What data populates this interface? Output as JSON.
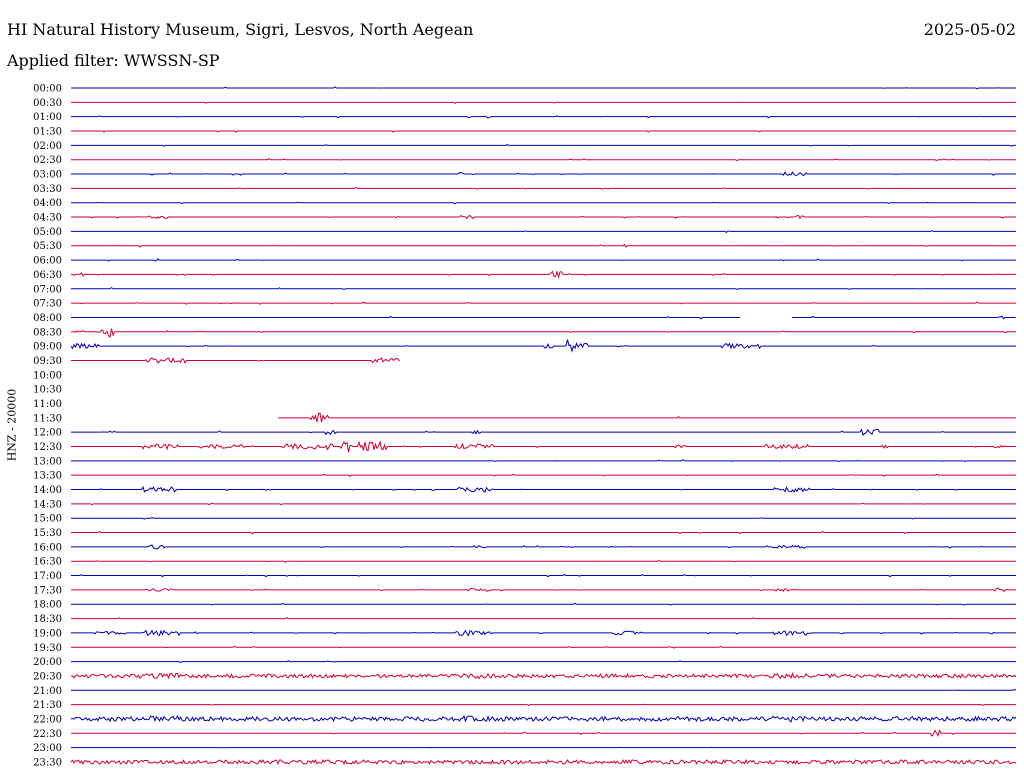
{
  "header": {
    "station": "HI Natural History Museum, Sigri, Lesvos, North Aegean",
    "date": "2025-05-02",
    "filter": "Applied filter: WWSSN-SP",
    "channel": "HNZ - 20000"
  },
  "colors": {
    "blue": "#0000aa",
    "red": "#cc0033"
  },
  "chart_data": {
    "type": "line",
    "title": "HI Natural History Museum, Sigri, Lesvos, North Aegean",
    "ylabel": "HNZ - 20000",
    "rows": [
      {
        "label": "00:00",
        "color": "blue"
      },
      {
        "label": "00:30",
        "color": "red"
      },
      {
        "label": "01:00",
        "color": "blue"
      },
      {
        "label": "01:30",
        "color": "red"
      },
      {
        "label": "02:00",
        "color": "blue"
      },
      {
        "label": "02:30",
        "color": "red"
      },
      {
        "label": "03:00",
        "color": "blue"
      },
      {
        "label": "03:30",
        "color": "red"
      },
      {
        "label": "04:00",
        "color": "blue"
      },
      {
        "label": "04:30",
        "color": "red"
      },
      {
        "label": "05:00",
        "color": "blue"
      },
      {
        "label": "05:30",
        "color": "red"
      },
      {
        "label": "06:00",
        "color": "blue"
      },
      {
        "label": "06:30",
        "color": "red"
      },
      {
        "label": "07:00",
        "color": "blue"
      },
      {
        "label": "07:30",
        "color": "red"
      },
      {
        "label": "08:00",
        "color": "blue"
      },
      {
        "label": "08:30",
        "color": "red"
      },
      {
        "label": "09:00",
        "color": "blue"
      },
      {
        "label": "09:30",
        "color": "red"
      },
      {
        "label": "10:00",
        "color": "blue"
      },
      {
        "label": "10:30",
        "color": "red"
      },
      {
        "label": "11:00",
        "color": "blue"
      },
      {
        "label": "11:30",
        "color": "red"
      },
      {
        "label": "12:00",
        "color": "blue"
      },
      {
        "label": "12:30",
        "color": "red"
      },
      {
        "label": "13:00",
        "color": "blue"
      },
      {
        "label": "13:30",
        "color": "red"
      },
      {
        "label": "14:00",
        "color": "blue"
      },
      {
        "label": "14:30",
        "color": "red"
      },
      {
        "label": "15:00",
        "color": "blue"
      },
      {
        "label": "15:30",
        "color": "red"
      },
      {
        "label": "16:00",
        "color": "blue"
      },
      {
        "label": "16:30",
        "color": "red"
      },
      {
        "label": "17:00",
        "color": "blue"
      },
      {
        "label": "17:30",
        "color": "red"
      },
      {
        "label": "18:00",
        "color": "blue"
      },
      {
        "label": "18:30",
        "color": "red"
      },
      {
        "label": "19:00",
        "color": "blue"
      },
      {
        "label": "19:30",
        "color": "red"
      },
      {
        "label": "20:00",
        "color": "blue"
      },
      {
        "label": "20:30",
        "color": "red"
      },
      {
        "label": "21:00",
        "color": "blue"
      },
      {
        "label": "21:30",
        "color": "red"
      },
      {
        "label": "22:00",
        "color": "blue"
      },
      {
        "label": "22:30",
        "color": "red"
      },
      {
        "label": "23:00",
        "color": "blue"
      },
      {
        "label": "23:30",
        "color": "red"
      }
    ]
  }
}
